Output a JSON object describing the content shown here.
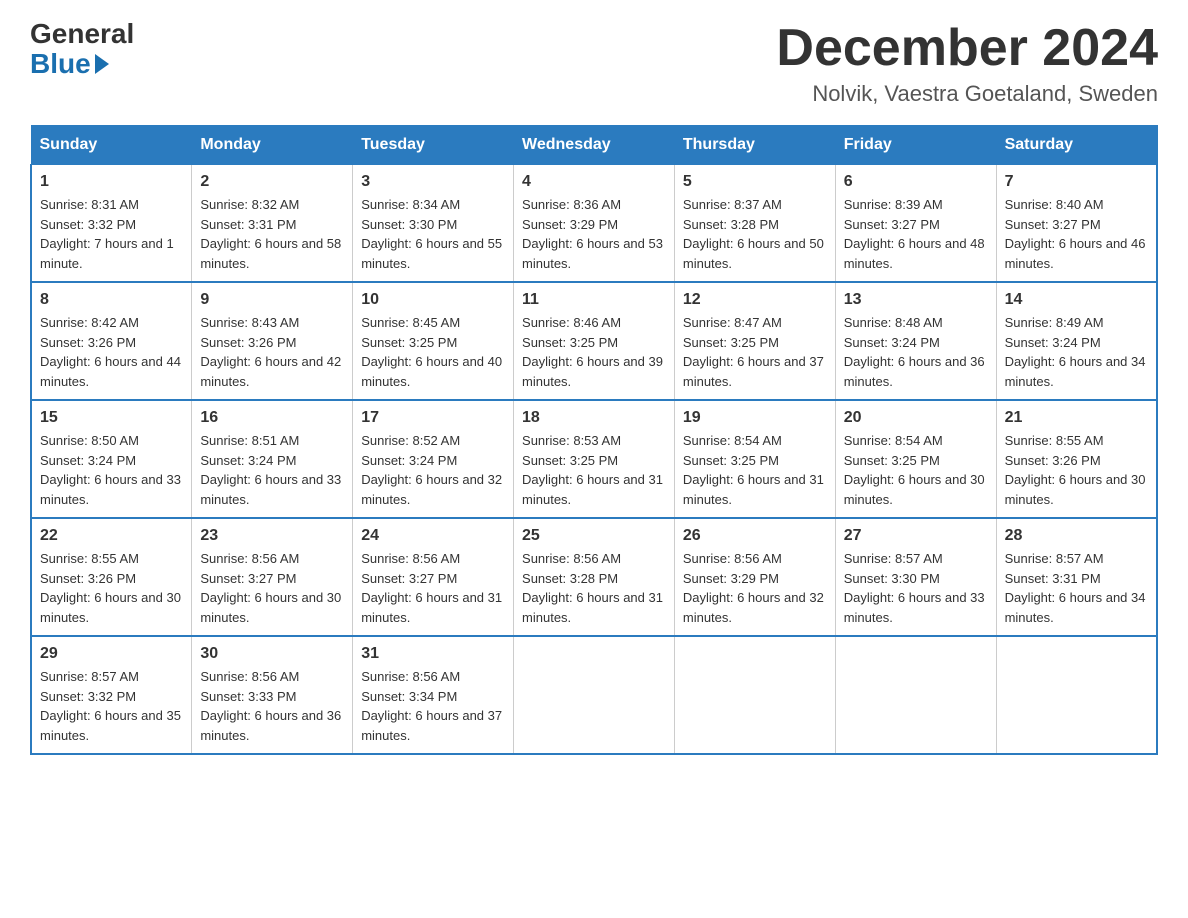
{
  "header": {
    "logo_general": "General",
    "logo_blue": "Blue",
    "month_title": "December 2024",
    "location": "Nolvik, Vaestra Goetaland, Sweden"
  },
  "days_of_week": [
    "Sunday",
    "Monday",
    "Tuesday",
    "Wednesday",
    "Thursday",
    "Friday",
    "Saturday"
  ],
  "weeks": [
    [
      {
        "day": "1",
        "sunrise": "8:31 AM",
        "sunset": "3:32 PM",
        "daylight": "7 hours and 1 minute."
      },
      {
        "day": "2",
        "sunrise": "8:32 AM",
        "sunset": "3:31 PM",
        "daylight": "6 hours and 58 minutes."
      },
      {
        "day": "3",
        "sunrise": "8:34 AM",
        "sunset": "3:30 PM",
        "daylight": "6 hours and 55 minutes."
      },
      {
        "day": "4",
        "sunrise": "8:36 AM",
        "sunset": "3:29 PM",
        "daylight": "6 hours and 53 minutes."
      },
      {
        "day": "5",
        "sunrise": "8:37 AM",
        "sunset": "3:28 PM",
        "daylight": "6 hours and 50 minutes."
      },
      {
        "day": "6",
        "sunrise": "8:39 AM",
        "sunset": "3:27 PM",
        "daylight": "6 hours and 48 minutes."
      },
      {
        "day": "7",
        "sunrise": "8:40 AM",
        "sunset": "3:27 PM",
        "daylight": "6 hours and 46 minutes."
      }
    ],
    [
      {
        "day": "8",
        "sunrise": "8:42 AM",
        "sunset": "3:26 PM",
        "daylight": "6 hours and 44 minutes."
      },
      {
        "day": "9",
        "sunrise": "8:43 AM",
        "sunset": "3:26 PM",
        "daylight": "6 hours and 42 minutes."
      },
      {
        "day": "10",
        "sunrise": "8:45 AM",
        "sunset": "3:25 PM",
        "daylight": "6 hours and 40 minutes."
      },
      {
        "day": "11",
        "sunrise": "8:46 AM",
        "sunset": "3:25 PM",
        "daylight": "6 hours and 39 minutes."
      },
      {
        "day": "12",
        "sunrise": "8:47 AM",
        "sunset": "3:25 PM",
        "daylight": "6 hours and 37 minutes."
      },
      {
        "day": "13",
        "sunrise": "8:48 AM",
        "sunset": "3:24 PM",
        "daylight": "6 hours and 36 minutes."
      },
      {
        "day": "14",
        "sunrise": "8:49 AM",
        "sunset": "3:24 PM",
        "daylight": "6 hours and 34 minutes."
      }
    ],
    [
      {
        "day": "15",
        "sunrise": "8:50 AM",
        "sunset": "3:24 PM",
        "daylight": "6 hours and 33 minutes."
      },
      {
        "day": "16",
        "sunrise": "8:51 AM",
        "sunset": "3:24 PM",
        "daylight": "6 hours and 33 minutes."
      },
      {
        "day": "17",
        "sunrise": "8:52 AM",
        "sunset": "3:24 PM",
        "daylight": "6 hours and 32 minutes."
      },
      {
        "day": "18",
        "sunrise": "8:53 AM",
        "sunset": "3:25 PM",
        "daylight": "6 hours and 31 minutes."
      },
      {
        "day": "19",
        "sunrise": "8:54 AM",
        "sunset": "3:25 PM",
        "daylight": "6 hours and 31 minutes."
      },
      {
        "day": "20",
        "sunrise": "8:54 AM",
        "sunset": "3:25 PM",
        "daylight": "6 hours and 30 minutes."
      },
      {
        "day": "21",
        "sunrise": "8:55 AM",
        "sunset": "3:26 PM",
        "daylight": "6 hours and 30 minutes."
      }
    ],
    [
      {
        "day": "22",
        "sunrise": "8:55 AM",
        "sunset": "3:26 PM",
        "daylight": "6 hours and 30 minutes."
      },
      {
        "day": "23",
        "sunrise": "8:56 AM",
        "sunset": "3:27 PM",
        "daylight": "6 hours and 30 minutes."
      },
      {
        "day": "24",
        "sunrise": "8:56 AM",
        "sunset": "3:27 PM",
        "daylight": "6 hours and 31 minutes."
      },
      {
        "day": "25",
        "sunrise": "8:56 AM",
        "sunset": "3:28 PM",
        "daylight": "6 hours and 31 minutes."
      },
      {
        "day": "26",
        "sunrise": "8:56 AM",
        "sunset": "3:29 PM",
        "daylight": "6 hours and 32 minutes."
      },
      {
        "day": "27",
        "sunrise": "8:57 AM",
        "sunset": "3:30 PM",
        "daylight": "6 hours and 33 minutes."
      },
      {
        "day": "28",
        "sunrise": "8:57 AM",
        "sunset": "3:31 PM",
        "daylight": "6 hours and 34 minutes."
      }
    ],
    [
      {
        "day": "29",
        "sunrise": "8:57 AM",
        "sunset": "3:32 PM",
        "daylight": "6 hours and 35 minutes."
      },
      {
        "day": "30",
        "sunrise": "8:56 AM",
        "sunset": "3:33 PM",
        "daylight": "6 hours and 36 minutes."
      },
      {
        "day": "31",
        "sunrise": "8:56 AM",
        "sunset": "3:34 PM",
        "daylight": "6 hours and 37 minutes."
      },
      null,
      null,
      null,
      null
    ]
  ]
}
